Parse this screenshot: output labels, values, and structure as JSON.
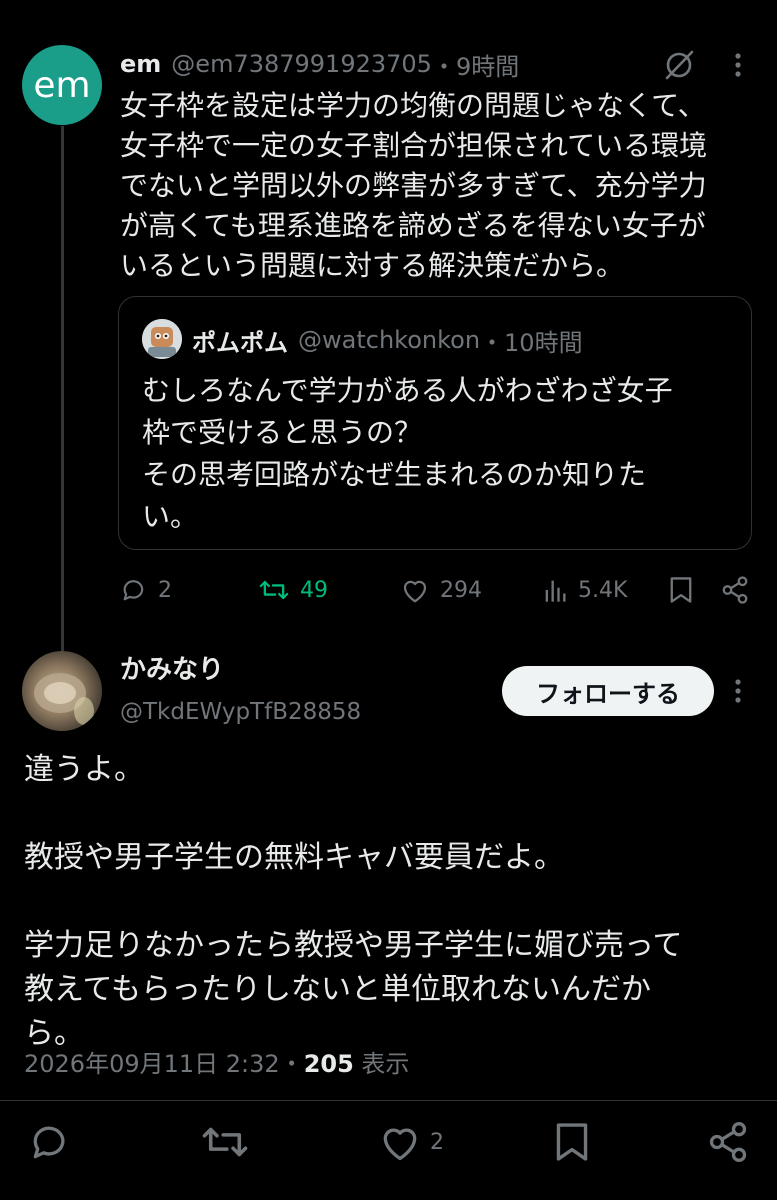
{
  "tweet": {
    "avatar_text": "em",
    "name": "em",
    "handle": "@em7387991923705",
    "time": "・9時間",
    "body": "女子枠を設定は学力の均衡の問題じゃなくて、\n女子枠で一定の女子割合が担保されている環境\nでないと学問以外の弊害が多すぎて、充分学力\nが高くても理系進路を諦めざるを得ない女子が\nいるという問題に対する解決策だから。",
    "quote": {
      "name": "ポムポム",
      "handle": "@watchkonkon",
      "time": "・10時間",
      "body": "むしろなんで学力がある人がわざわざ女子\n枠で受けると思うの？\nその思考回路がなぜ生まれるのか知りた\nい。"
    },
    "actions": {
      "replies": "2",
      "retweets": "49",
      "likes": "294",
      "views": "5.4K"
    },
    "retweet_color": "#00ba7c"
  },
  "reply": {
    "name": "かみなり",
    "handle": "@TkdEWypTfB28858",
    "follow_label": "フォローする",
    "body": "違うよ。\n\n教授や男子学生の無料キャバ要員だよ。\n\n学力足りなかったら教授や男子学生に媚び売って\n教えてもらったりしないと単位取れないんだか\nら。",
    "date": "2026年09月11日 2:32・",
    "views_count": "205",
    "views_label": " 表示",
    "like_count": "2"
  }
}
